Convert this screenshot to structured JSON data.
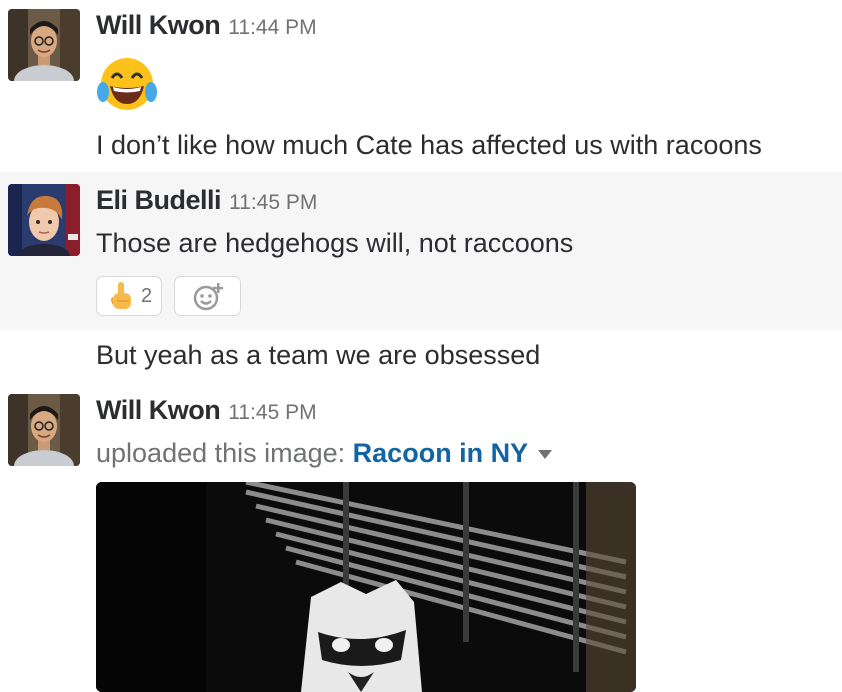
{
  "messages": [
    {
      "author": "Will Kwon",
      "time": "11:44 PM",
      "emoji": "😂",
      "text": "I don’t like how much Cate has affected us with racoons"
    },
    {
      "author": "Eli Budelli",
      "time": "11:45 PM",
      "text": "Those are hedgehogs will, not raccoons",
      "reaction": {
        "emoji": "☝️",
        "count": "2"
      },
      "followup": "But yeah as a team we are obsessed"
    },
    {
      "author": "Will Kwon",
      "time": "11:45 PM",
      "upload_prefix": "uploaded this image: ",
      "file_name": "Racoon in NY"
    }
  ],
  "colors": {
    "text": "#2c2d30",
    "muted": "#717274",
    "link": "#1264a3",
    "highlight": "#f6f6f6"
  },
  "icons": [
    "add-reaction-icon",
    "dropdown-caret-icon"
  ]
}
